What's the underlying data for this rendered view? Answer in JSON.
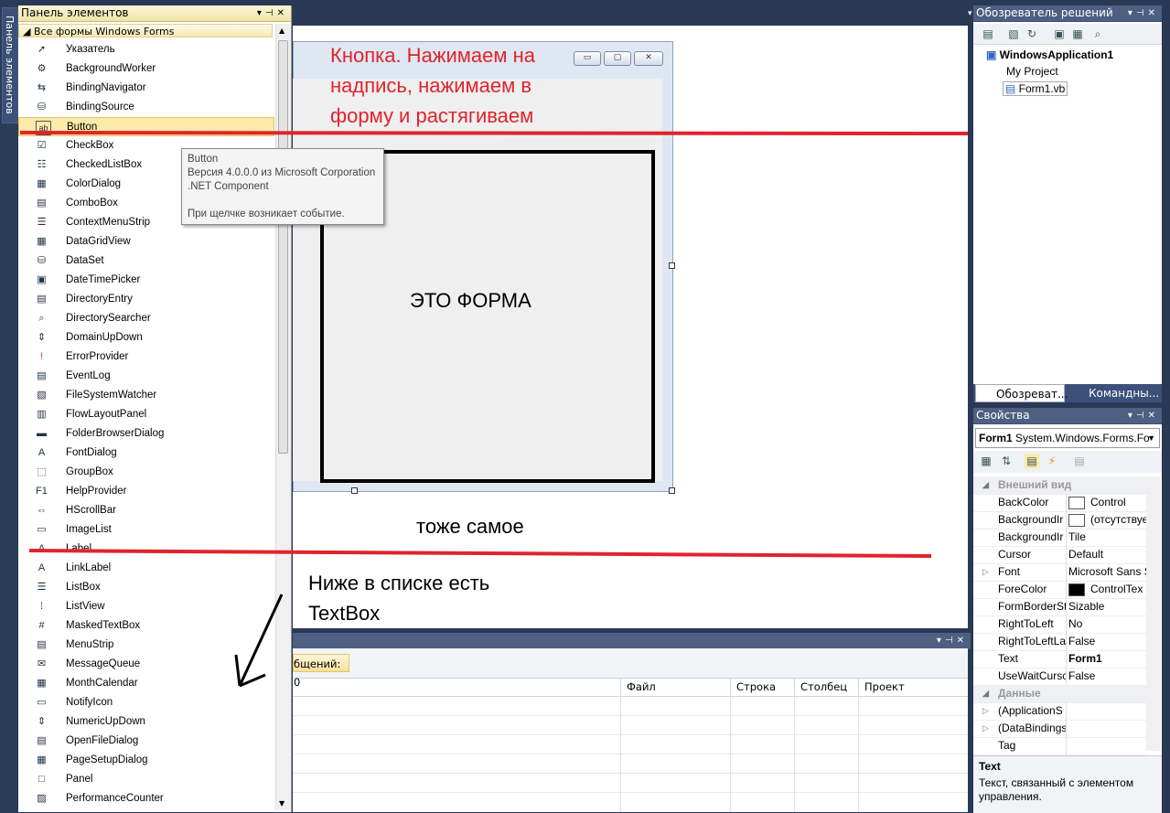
{
  "toolbox": {
    "title": "Панель элементов",
    "side_tab": "Панель элементов",
    "category": "Все формы Windows Forms",
    "items": [
      {
        "label": "Указатель",
        "icon": "pointer-icon",
        "glyph": "➚"
      },
      {
        "label": "BackgroundWorker",
        "icon": "background-worker-icon",
        "glyph": "⚙"
      },
      {
        "label": "BindingNavigator",
        "icon": "binding-navigator-icon",
        "glyph": "⇆"
      },
      {
        "label": "BindingSource",
        "icon": "binding-source-icon",
        "glyph": "⛁"
      },
      {
        "label": "Button",
        "icon": "button-icon",
        "glyph": "ab"
      },
      {
        "label": "CheckBox",
        "icon": "checkbox-icon",
        "glyph": "☑"
      },
      {
        "label": "CheckedListBox",
        "icon": "checked-list-box-icon",
        "glyph": "☷"
      },
      {
        "label": "ColorDialog",
        "icon": "color-dialog-icon",
        "glyph": "▦"
      },
      {
        "label": "ComboBox",
        "icon": "combobox-icon",
        "glyph": "▤"
      },
      {
        "label": "ContextMenuStrip",
        "icon": "context-menu-icon",
        "glyph": "☰"
      },
      {
        "label": "DataGridView",
        "icon": "data-grid-icon",
        "glyph": "▦"
      },
      {
        "label": "DataSet",
        "icon": "dataset-icon",
        "glyph": "⛁"
      },
      {
        "label": "DateTimePicker",
        "icon": "date-time-picker-icon",
        "glyph": "▣"
      },
      {
        "label": "DirectoryEntry",
        "icon": "directory-entry-icon",
        "glyph": "▤"
      },
      {
        "label": "DirectorySearcher",
        "icon": "directory-searcher-icon",
        "glyph": "⌕"
      },
      {
        "label": "DomainUpDown",
        "icon": "domain-updown-icon",
        "glyph": "⇕"
      },
      {
        "label": "ErrorProvider",
        "icon": "error-provider-icon",
        "glyph": "!"
      },
      {
        "label": "EventLog",
        "icon": "event-log-icon",
        "glyph": "▤"
      },
      {
        "label": "FileSystemWatcher",
        "icon": "file-watcher-icon",
        "glyph": "▧"
      },
      {
        "label": "FlowLayoutPanel",
        "icon": "flow-layout-icon",
        "glyph": "▥"
      },
      {
        "label": "FolderBrowserDialog",
        "icon": "folder-browser-icon",
        "glyph": "▬"
      },
      {
        "label": "FontDialog",
        "icon": "font-dialog-icon",
        "glyph": "A"
      },
      {
        "label": "GroupBox",
        "icon": "groupbox-icon",
        "glyph": "⬚"
      },
      {
        "label": "HelpProvider",
        "icon": "help-provider-icon",
        "glyph": "F1"
      },
      {
        "label": "HScrollBar",
        "icon": "hscrollbar-icon",
        "glyph": "⇔"
      },
      {
        "label": "ImageList",
        "icon": "image-list-icon",
        "glyph": "▭"
      },
      {
        "label": "Label",
        "icon": "label-icon",
        "glyph": "A"
      },
      {
        "label": "LinkLabel",
        "icon": "link-label-icon",
        "glyph": "A"
      },
      {
        "label": "ListBox",
        "icon": "listbox-icon",
        "glyph": "☰"
      },
      {
        "label": "ListView",
        "icon": "listview-icon",
        "glyph": "⁞"
      },
      {
        "label": "MaskedTextBox",
        "icon": "masked-textbox-icon",
        "glyph": "#"
      },
      {
        "label": "MenuStrip",
        "icon": "menu-strip-icon",
        "glyph": "▤"
      },
      {
        "label": "MessageQueue",
        "icon": "message-queue-icon",
        "glyph": "✉"
      },
      {
        "label": "MonthCalendar",
        "icon": "month-calendar-icon",
        "glyph": "▦"
      },
      {
        "label": "NotifyIcon",
        "icon": "notify-icon-icon",
        "glyph": "▭"
      },
      {
        "label": "NumericUpDown",
        "icon": "numeric-updown-icon",
        "glyph": "⇕"
      },
      {
        "label": "OpenFileDialog",
        "icon": "open-file-dialog-icon",
        "glyph": "▤"
      },
      {
        "label": "PageSetupDialog",
        "icon": "page-setup-icon",
        "glyph": "▦"
      },
      {
        "label": "Panel",
        "icon": "panel-icon",
        "glyph": "□"
      },
      {
        "label": "PerformanceCounter",
        "icon": "performance-counter-icon",
        "glyph": "▨"
      }
    ]
  },
  "tooltip": {
    "title": "Button",
    "version": "Версия 4.0.0.0 из Microsoft Corporation",
    "component": ".NET Component",
    "description": "При щелчке возникает событие."
  },
  "form": {
    "label": "ЭТО ФОРМА",
    "min_glyph": "▭",
    "max_glyph": "▢",
    "close_glyph": "✕"
  },
  "annotations": {
    "red_line1": "Кнопка. Нажимаем на",
    "red_line2": "надпись, нажимаем в",
    "red_line3": "форму и растягиваем",
    "same": "тоже самое",
    "below1": "Ниже в списке есть",
    "below2": "TextBox",
    "red_line_color": "#e0242b"
  },
  "error_list": {
    "messages_button": "бщений: 0",
    "columns": [
      "Файл",
      "Строка",
      "Столбец",
      "Проект"
    ]
  },
  "solution_explorer": {
    "title": "Обозреватель решений",
    "solution": "WindowsApplication1",
    "my_project": "My Project",
    "file": "Form1.vb",
    "tab1": "Обозреват...",
    "tab2": "Командны..."
  },
  "properties": {
    "title": "Свойства",
    "object_name": "Form1",
    "object_type": "System.Windows.Forms.Fo",
    "rows": [
      {
        "name": "Внешний вид",
        "value": "",
        "category": true
      },
      {
        "name": "BackColor",
        "value": "Control",
        "swatch": "#ffffff"
      },
      {
        "name": "BackgroundIr",
        "value": "(отсутствуе",
        "swatch": "#ffffff"
      },
      {
        "name": "BackgroundIr",
        "value": "Tile"
      },
      {
        "name": "Cursor",
        "value": "Default"
      },
      {
        "name": "Font",
        "value": "Microsoft Sans S",
        "expand": true
      },
      {
        "name": "ForeColor",
        "value": "ControlTex",
        "swatch": "#000000"
      },
      {
        "name": "FormBorderSt",
        "value": "Sizable"
      },
      {
        "name": "RightToLeft",
        "value": "No"
      },
      {
        "name": "RightToLeftLa",
        "value": "False"
      },
      {
        "name": "Text",
        "value": "Form1",
        "bold": true
      },
      {
        "name": "UseWaitCursc",
        "value": "False"
      },
      {
        "name": "Данные",
        "value": "",
        "category": true
      },
      {
        "name": "(ApplicationS",
        "value": "",
        "expand": true
      },
      {
        "name": "(DataBindings",
        "value": "",
        "expand": true
      },
      {
        "name": "Tag",
        "value": ""
      }
    ],
    "desc_title": "Text",
    "desc_text": "Текст, связанный с элементом управления."
  }
}
